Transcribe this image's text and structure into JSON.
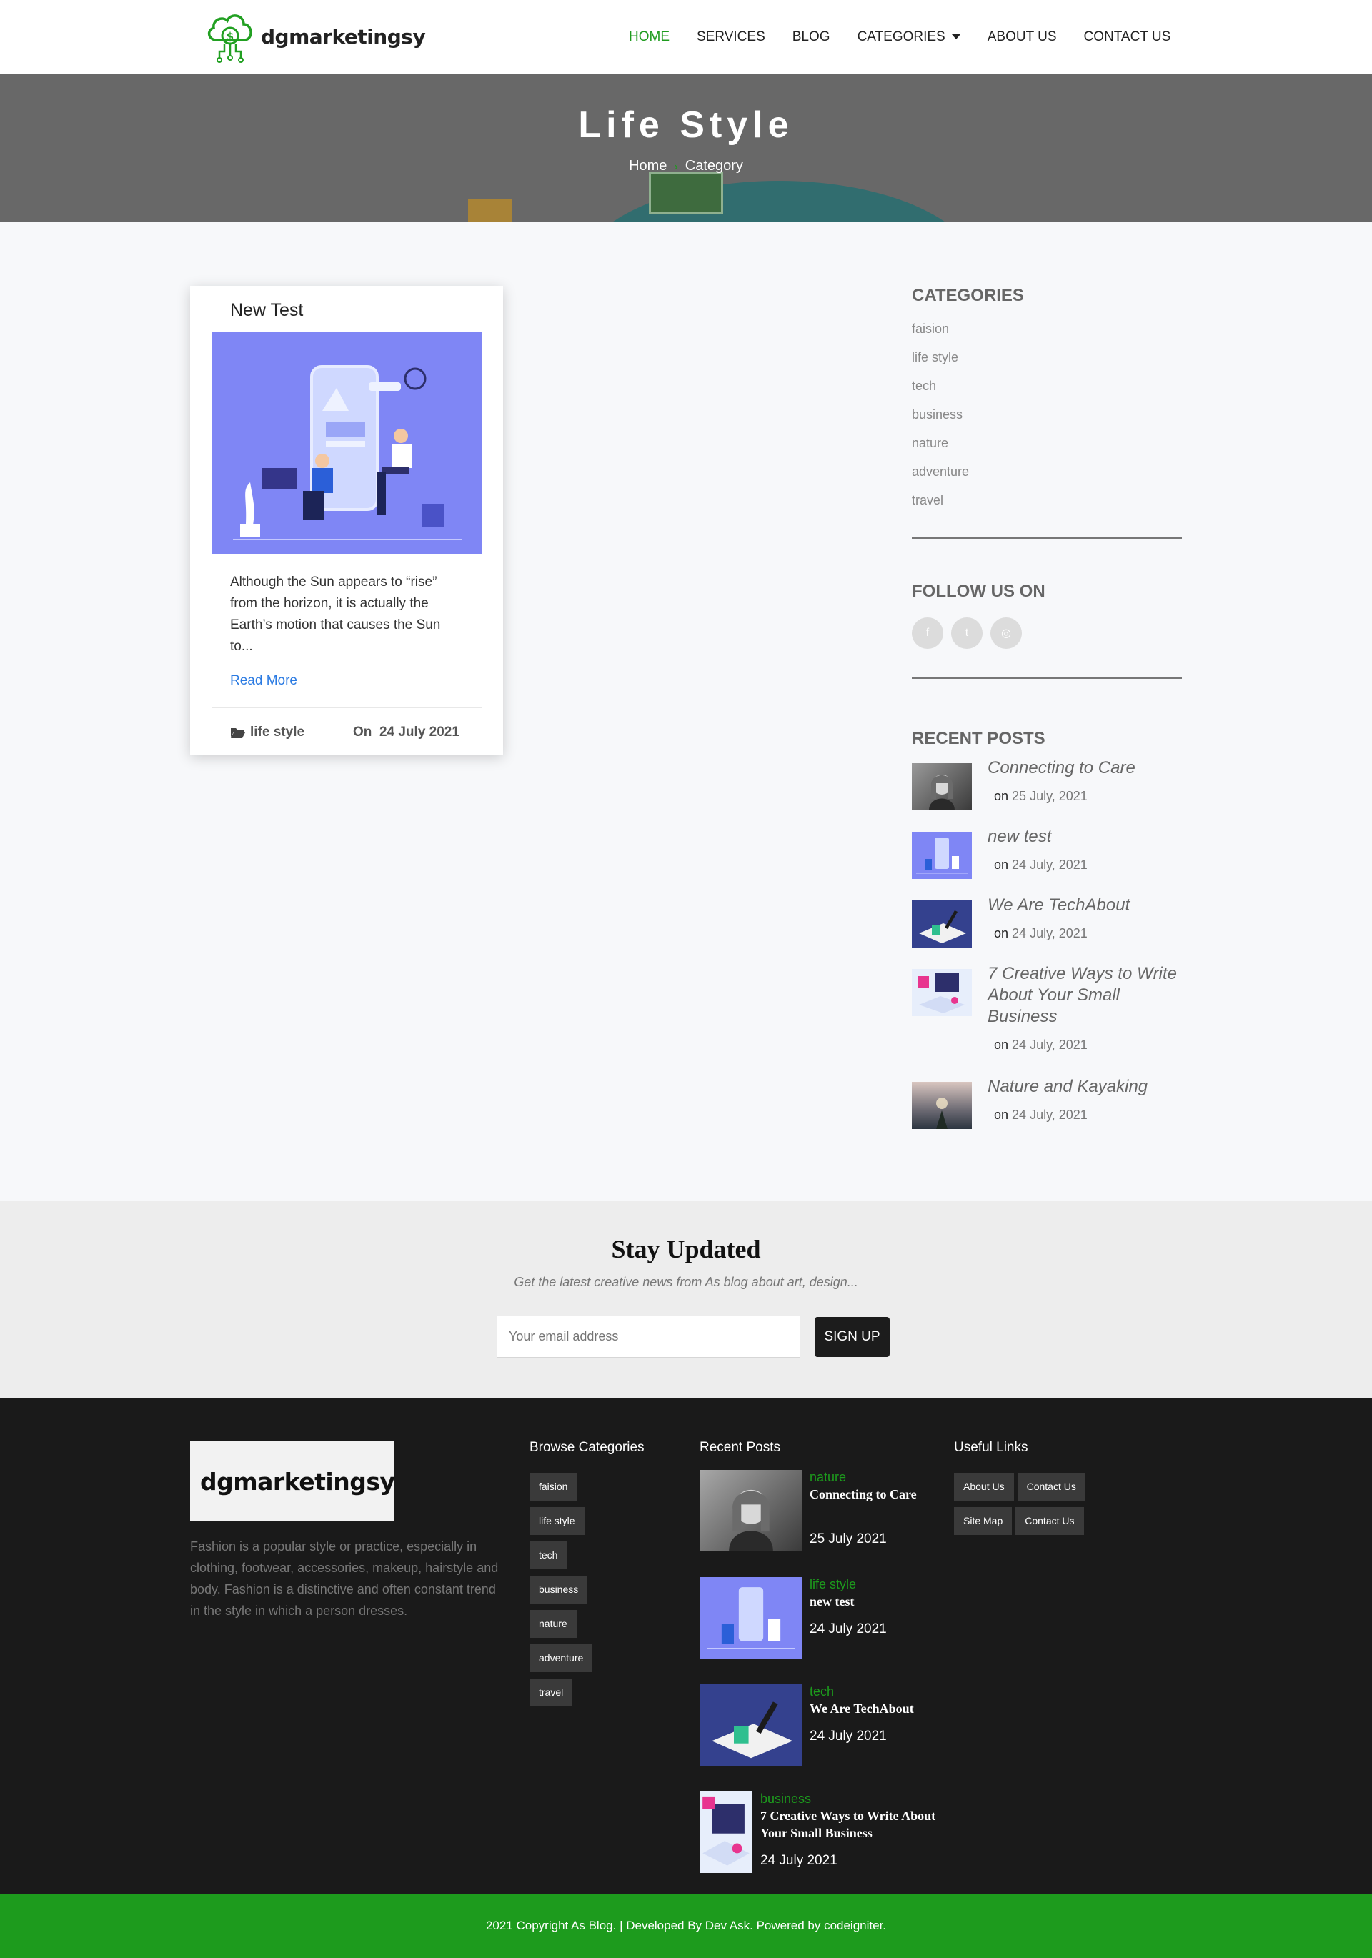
{
  "brand": {
    "name": "dgmarketingsy",
    "accent": "#1d9b1d"
  },
  "nav": {
    "items": [
      {
        "label": "HOME",
        "active": true
      },
      {
        "label": "SERVICES"
      },
      {
        "label": "BLOG"
      },
      {
        "label": "CATEGORIES",
        "dropdown": true
      },
      {
        "label": "ABOUT US"
      },
      {
        "label": "CONTACT US"
      }
    ]
  },
  "hero": {
    "title": "Life Style",
    "breadcrumb_home": "Home",
    "breadcrumb_current": "Category"
  },
  "post": {
    "title": "New Test",
    "excerpt": "Although the Sun appears to “rise” from the horizon, it is actually the Earth’s motion that causes the Sun to...",
    "read_more": "Read More",
    "category": "life style",
    "date_prefix": "On",
    "date": "24 July 2021"
  },
  "sidebar": {
    "categories_heading": "CATEGORIES",
    "categories": [
      "faision",
      "life style",
      "tech",
      "business",
      "nature",
      "adventure",
      "travel"
    ],
    "follow_heading": "FOLLOW US ON",
    "social": [
      {
        "icon": "facebook-icon",
        "glyph": "f"
      },
      {
        "icon": "twitter-icon",
        "glyph": "t"
      },
      {
        "icon": "instagram-icon",
        "glyph": "◎"
      }
    ],
    "recent_heading": "RECENT POSTS",
    "recent_on": "on",
    "recent": [
      {
        "title": "Connecting to Care",
        "date": "25 July, 2021"
      },
      {
        "title": "new test",
        "date": "24 July, 2021"
      },
      {
        "title": "We Are TechAbout",
        "date": "24 July, 2021"
      },
      {
        "title": "7 Creative Ways to Write About Your Small Business",
        "date": "24 July, 2021"
      },
      {
        "title": "Nature and Kayaking",
        "date": "24 July, 2021"
      }
    ]
  },
  "newsletter": {
    "title": "Stay Updated",
    "subtitle": "Get the latest creative news from As blog about art, design...",
    "placeholder": "Your email address",
    "button": "SIGN UP"
  },
  "footer": {
    "about": "Fashion is a popular style or practice, especially in clothing, footwear, accessories, makeup, hairstyle and body. Fashion is a distinctive and often constant trend in the style in which a person dresses.",
    "browse_heading": "Browse Categories",
    "tags": [
      "faision",
      "life style",
      "tech",
      "business",
      "nature",
      "adventure",
      "travel"
    ],
    "recent_heading": "Recent Posts",
    "recent": [
      {
        "category": "nature",
        "title": "Connecting to Care",
        "date": "25 July 2021"
      },
      {
        "category": "life style",
        "title": "new test",
        "date": "24 July 2021"
      },
      {
        "category": "tech",
        "title": "We Are TechAbout",
        "date": "24 July 2021"
      },
      {
        "category": "business",
        "title": "7 Creative Ways to Write About Your Small Business",
        "date": "24 July 2021"
      }
    ],
    "links_heading": "Useful Links",
    "links": [
      "About Us",
      "Contact Us",
      "Site Map",
      "Contact Us"
    ],
    "copyright": "2021 Copyright As Blog. | Developed By Dev Ask. Powered by codeigniter."
  }
}
